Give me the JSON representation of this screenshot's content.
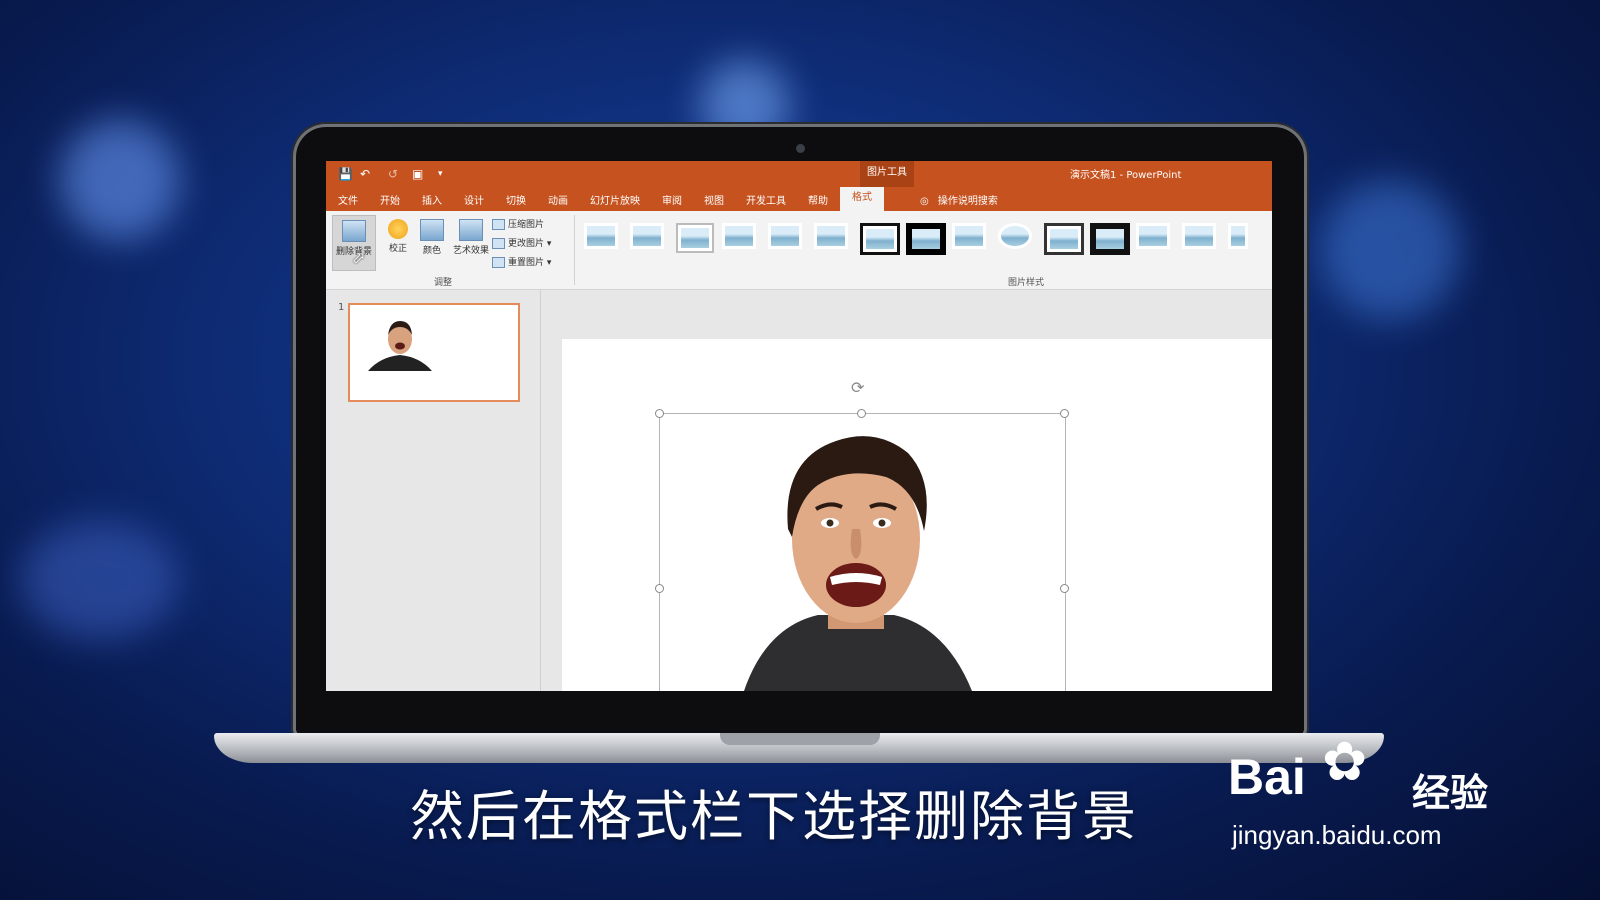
{
  "app": {
    "window_title": "演示文稿1 - PowerPoint",
    "context_tab_group": "图片工具",
    "search_hint": "操作说明搜索",
    "accent_color": "#c6521f"
  },
  "tabs": [
    {
      "label": "文件"
    },
    {
      "label": "开始"
    },
    {
      "label": "插入"
    },
    {
      "label": "设计"
    },
    {
      "label": "切换"
    },
    {
      "label": "动画"
    },
    {
      "label": "幻灯片放映"
    },
    {
      "label": "审阅"
    },
    {
      "label": "视图"
    },
    {
      "label": "开发工具"
    },
    {
      "label": "帮助"
    },
    {
      "label": "格式"
    }
  ],
  "ribbon": {
    "remove_background": "删除背景",
    "corrections": "校正",
    "color": "颜色",
    "artistic_effects": "艺术效果",
    "compress": "压缩图片",
    "change_picture": "更改图片",
    "reset_picture": "重置图片",
    "adjust_group": "调整",
    "styles_group": "图片样式"
  },
  "slides": {
    "thumbnail_number": "1"
  },
  "caption": "然后在格式栏下选择删除背景",
  "watermark": {
    "brand": "Bai",
    "brand_cn": "经验",
    "url": "jingyan.baidu.com"
  }
}
